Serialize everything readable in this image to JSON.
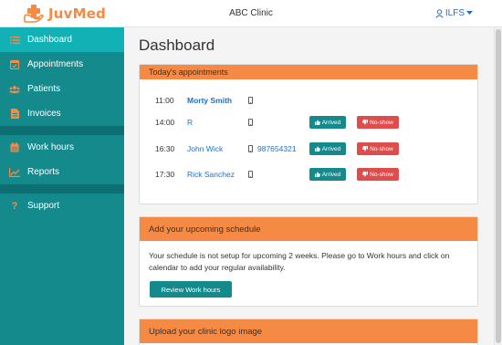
{
  "header": {
    "logo_text": "JuvMed",
    "clinic_name": "ABC Clinic",
    "user_label": "ILFS",
    "brand_color": "#f58a45"
  },
  "sidebar": {
    "items": [
      {
        "label": "Dashboard",
        "icon": "list-icon",
        "active": true
      },
      {
        "label": "Appointments",
        "icon": "calendar-check-icon"
      },
      {
        "label": "Patients",
        "icon": "users-icon"
      },
      {
        "label": "Invoices",
        "icon": "file-invoice-icon"
      },
      {
        "label": "Work hours",
        "icon": "calendar-icon"
      },
      {
        "label": "Reports",
        "icon": "chart-icon"
      },
      {
        "label": "Support",
        "icon": "question-icon"
      }
    ],
    "color": "#158a8d",
    "active_color": "#12b1b5"
  },
  "main": {
    "title": "Dashboard",
    "appointments_card": {
      "title": "Today's appointments",
      "arrived_label": "Arrived",
      "noshow_label": "No-show",
      "rows": [
        {
          "time": "11:00",
          "name": "Morty Smith",
          "phone": ""
        },
        {
          "time": "14:00",
          "name": "R",
          "phone": ""
        },
        {
          "time": "16:30",
          "name": "John Wick",
          "phone": "987654321"
        },
        {
          "time": "17:30",
          "name": "Rick Sanchez",
          "phone": ""
        }
      ]
    },
    "schedule_card": {
      "title": "Add your upcoming schedule",
      "text": "Your schedule is not setup for upcoming 2 weeks. Please go to Work hours and click on calendar to add your regular availability.",
      "button_label": "Review Work hours"
    },
    "logo_card": {
      "title": "Upload your clinic logo image"
    }
  }
}
